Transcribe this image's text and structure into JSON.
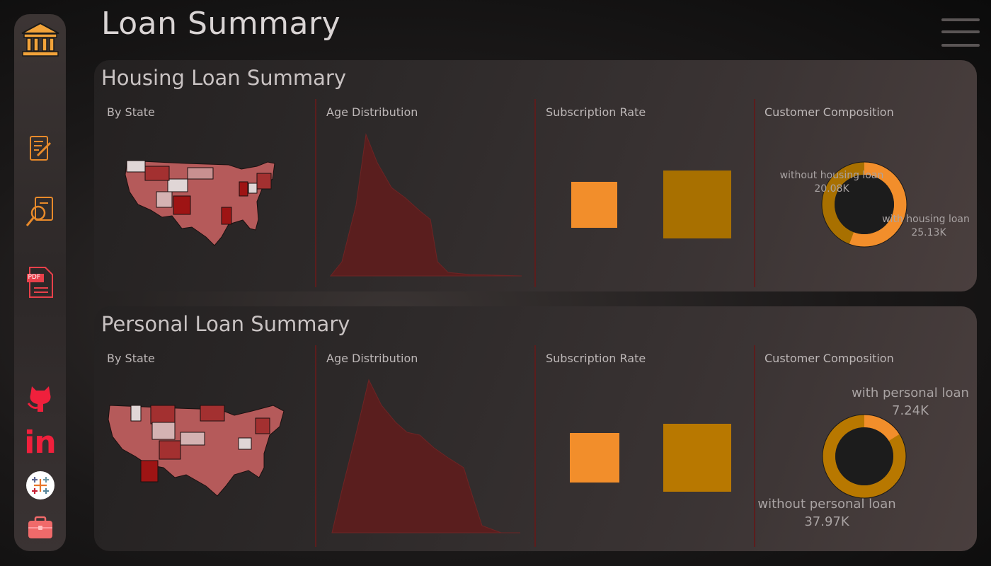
{
  "page": {
    "title": "Loan Summary"
  },
  "sidebar": {
    "icons": [
      {
        "name": "bank-icon"
      },
      {
        "name": "notes-icon"
      },
      {
        "name": "document-search-icon"
      },
      {
        "name": "pdf-icon",
        "label": "PDF"
      },
      {
        "name": "github-icon"
      },
      {
        "name": "linkedin-icon",
        "label": "in"
      },
      {
        "name": "tableau-icon"
      },
      {
        "name": "briefcase-icon"
      }
    ]
  },
  "panels": [
    {
      "title": "Housing Loan Summary",
      "by_state": "By State",
      "age_distribution": "Age Distribution",
      "subscription_rate": "Subscription Rate",
      "customer_composition": "Customer Composition",
      "donut": {
        "segments": [
          {
            "label": "without housing loan",
            "value": "20.08K",
            "value_num": 20.08,
            "color": "#a87000"
          },
          {
            "label": "with housing loan",
            "value": "25.13K",
            "value_num": 25.13,
            "color": "#f28e2b"
          }
        ]
      },
      "squares": [
        {
          "color": "#f28e2b"
        },
        {
          "color": "#a87000"
        }
      ]
    },
    {
      "title": "Personal Loan Summary",
      "by_state": "By State",
      "age_distribution": "Age Distribution",
      "subscription_rate": "Subscription Rate",
      "customer_composition": "Customer Composition",
      "donut": {
        "segments": [
          {
            "label": "with personal loan",
            "value": "7.24K",
            "value_num": 7.24,
            "color": "#f28e2b"
          },
          {
            "label": "without personal loan",
            "value": "37.97K",
            "value_num": 37.97,
            "color": "#b87800"
          }
        ]
      },
      "squares": [
        {
          "color": "#f28e2b"
        },
        {
          "color": "#b87800"
        }
      ]
    }
  ],
  "colors": {
    "accent": "#f28e2b",
    "dark_gold": "#a87000",
    "map_dark": "#9e1414",
    "map_light": "#e0d6d6",
    "area": "#5a1e1e"
  }
}
